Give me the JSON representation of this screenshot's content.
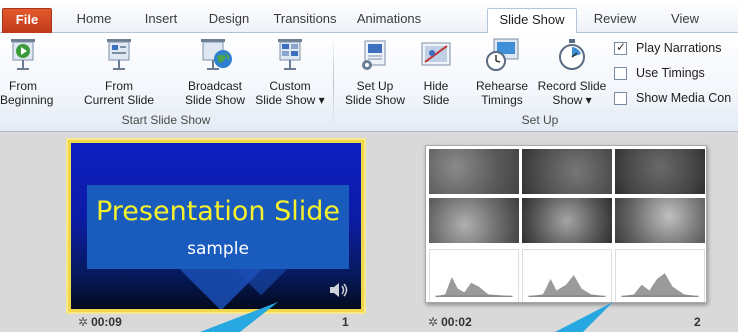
{
  "tabs": [
    "File",
    "Home",
    "Insert",
    "Design",
    "Transitions",
    "Animations",
    "Slide Show",
    "Review",
    "View"
  ],
  "active_tab": "Slide Show",
  "ribbon": {
    "start_group": {
      "label": "Start Slide Show",
      "from_beginning": [
        "From",
        "Beginning"
      ],
      "from_current": [
        "From",
        "Current Slide"
      ],
      "broadcast": [
        "Broadcast",
        "Slide Show"
      ],
      "custom": [
        "Custom",
        "Slide Show ▾"
      ]
    },
    "setup_group": {
      "label": "Set Up",
      "setup_show": [
        "Set Up",
        "Slide Show"
      ],
      "hide_slide": [
        "Hide",
        "Slide"
      ],
      "rehearse": [
        "Rehearse",
        "Timings"
      ],
      "record": [
        "Record Slide",
        "Show ▾"
      ],
      "play_narrations": {
        "label": "Play Narrations",
        "checked": true
      },
      "use_timings": {
        "label": "Use Timings",
        "checked": false
      },
      "show_media_controls": {
        "label": "Show Media Con",
        "checked": false
      }
    }
  },
  "slides": [
    {
      "number": "1",
      "time": "00:09",
      "title": "Presentation Slide",
      "subtitle": "sample",
      "selected": true
    },
    {
      "number": "2",
      "time": "00:02",
      "selected": false
    }
  ],
  "colors": {
    "file_tab": "#d04a22",
    "selection_border": "#f1d84b",
    "slide_title": "#f6f12b",
    "pointer": "#27a8e0"
  }
}
